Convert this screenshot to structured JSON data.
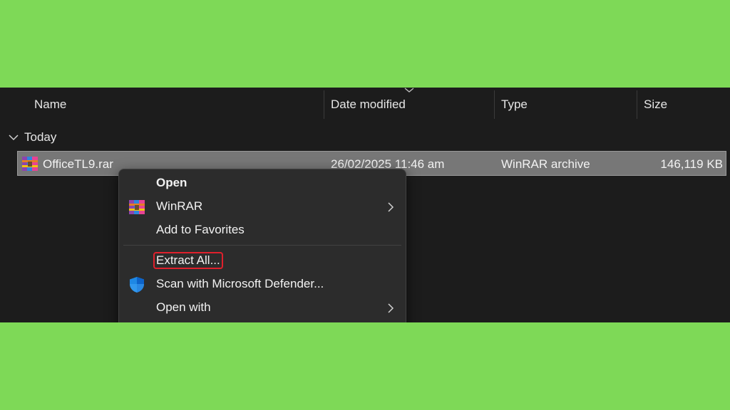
{
  "columns": {
    "name": "Name",
    "date_modified": "Date modified",
    "type": "Type",
    "size": "Size"
  },
  "group": {
    "label": "Today"
  },
  "file": {
    "name": "OfficeTL9.rar",
    "date_modified": "26/02/2025 11:46 am",
    "type": "WinRAR archive",
    "size": "146,119 KB",
    "icon": "winrar-archive-icon"
  },
  "context_menu": {
    "items": [
      {
        "label": "Open",
        "bold": true,
        "icon": null,
        "submenu": false
      },
      {
        "label": "WinRAR",
        "bold": false,
        "icon": "winrar-icon",
        "submenu": true
      },
      {
        "label": "Add to Favorites",
        "bold": false,
        "icon": null,
        "submenu": false
      },
      {
        "label": "Extract All...",
        "bold": false,
        "icon": null,
        "submenu": false,
        "highlighted": true
      },
      {
        "label": "Scan with Microsoft Defender...",
        "bold": false,
        "icon": "defender-shield-icon",
        "submenu": false
      },
      {
        "label": "Open with",
        "bold": false,
        "icon": null,
        "submenu": true
      }
    ]
  },
  "colors": {
    "background_frame": "#7ed957",
    "explorer_bg": "#1c1c1c",
    "selected_row": "#777777",
    "menu_bg": "#2c2c2c",
    "highlight_border": "#e0202c"
  }
}
